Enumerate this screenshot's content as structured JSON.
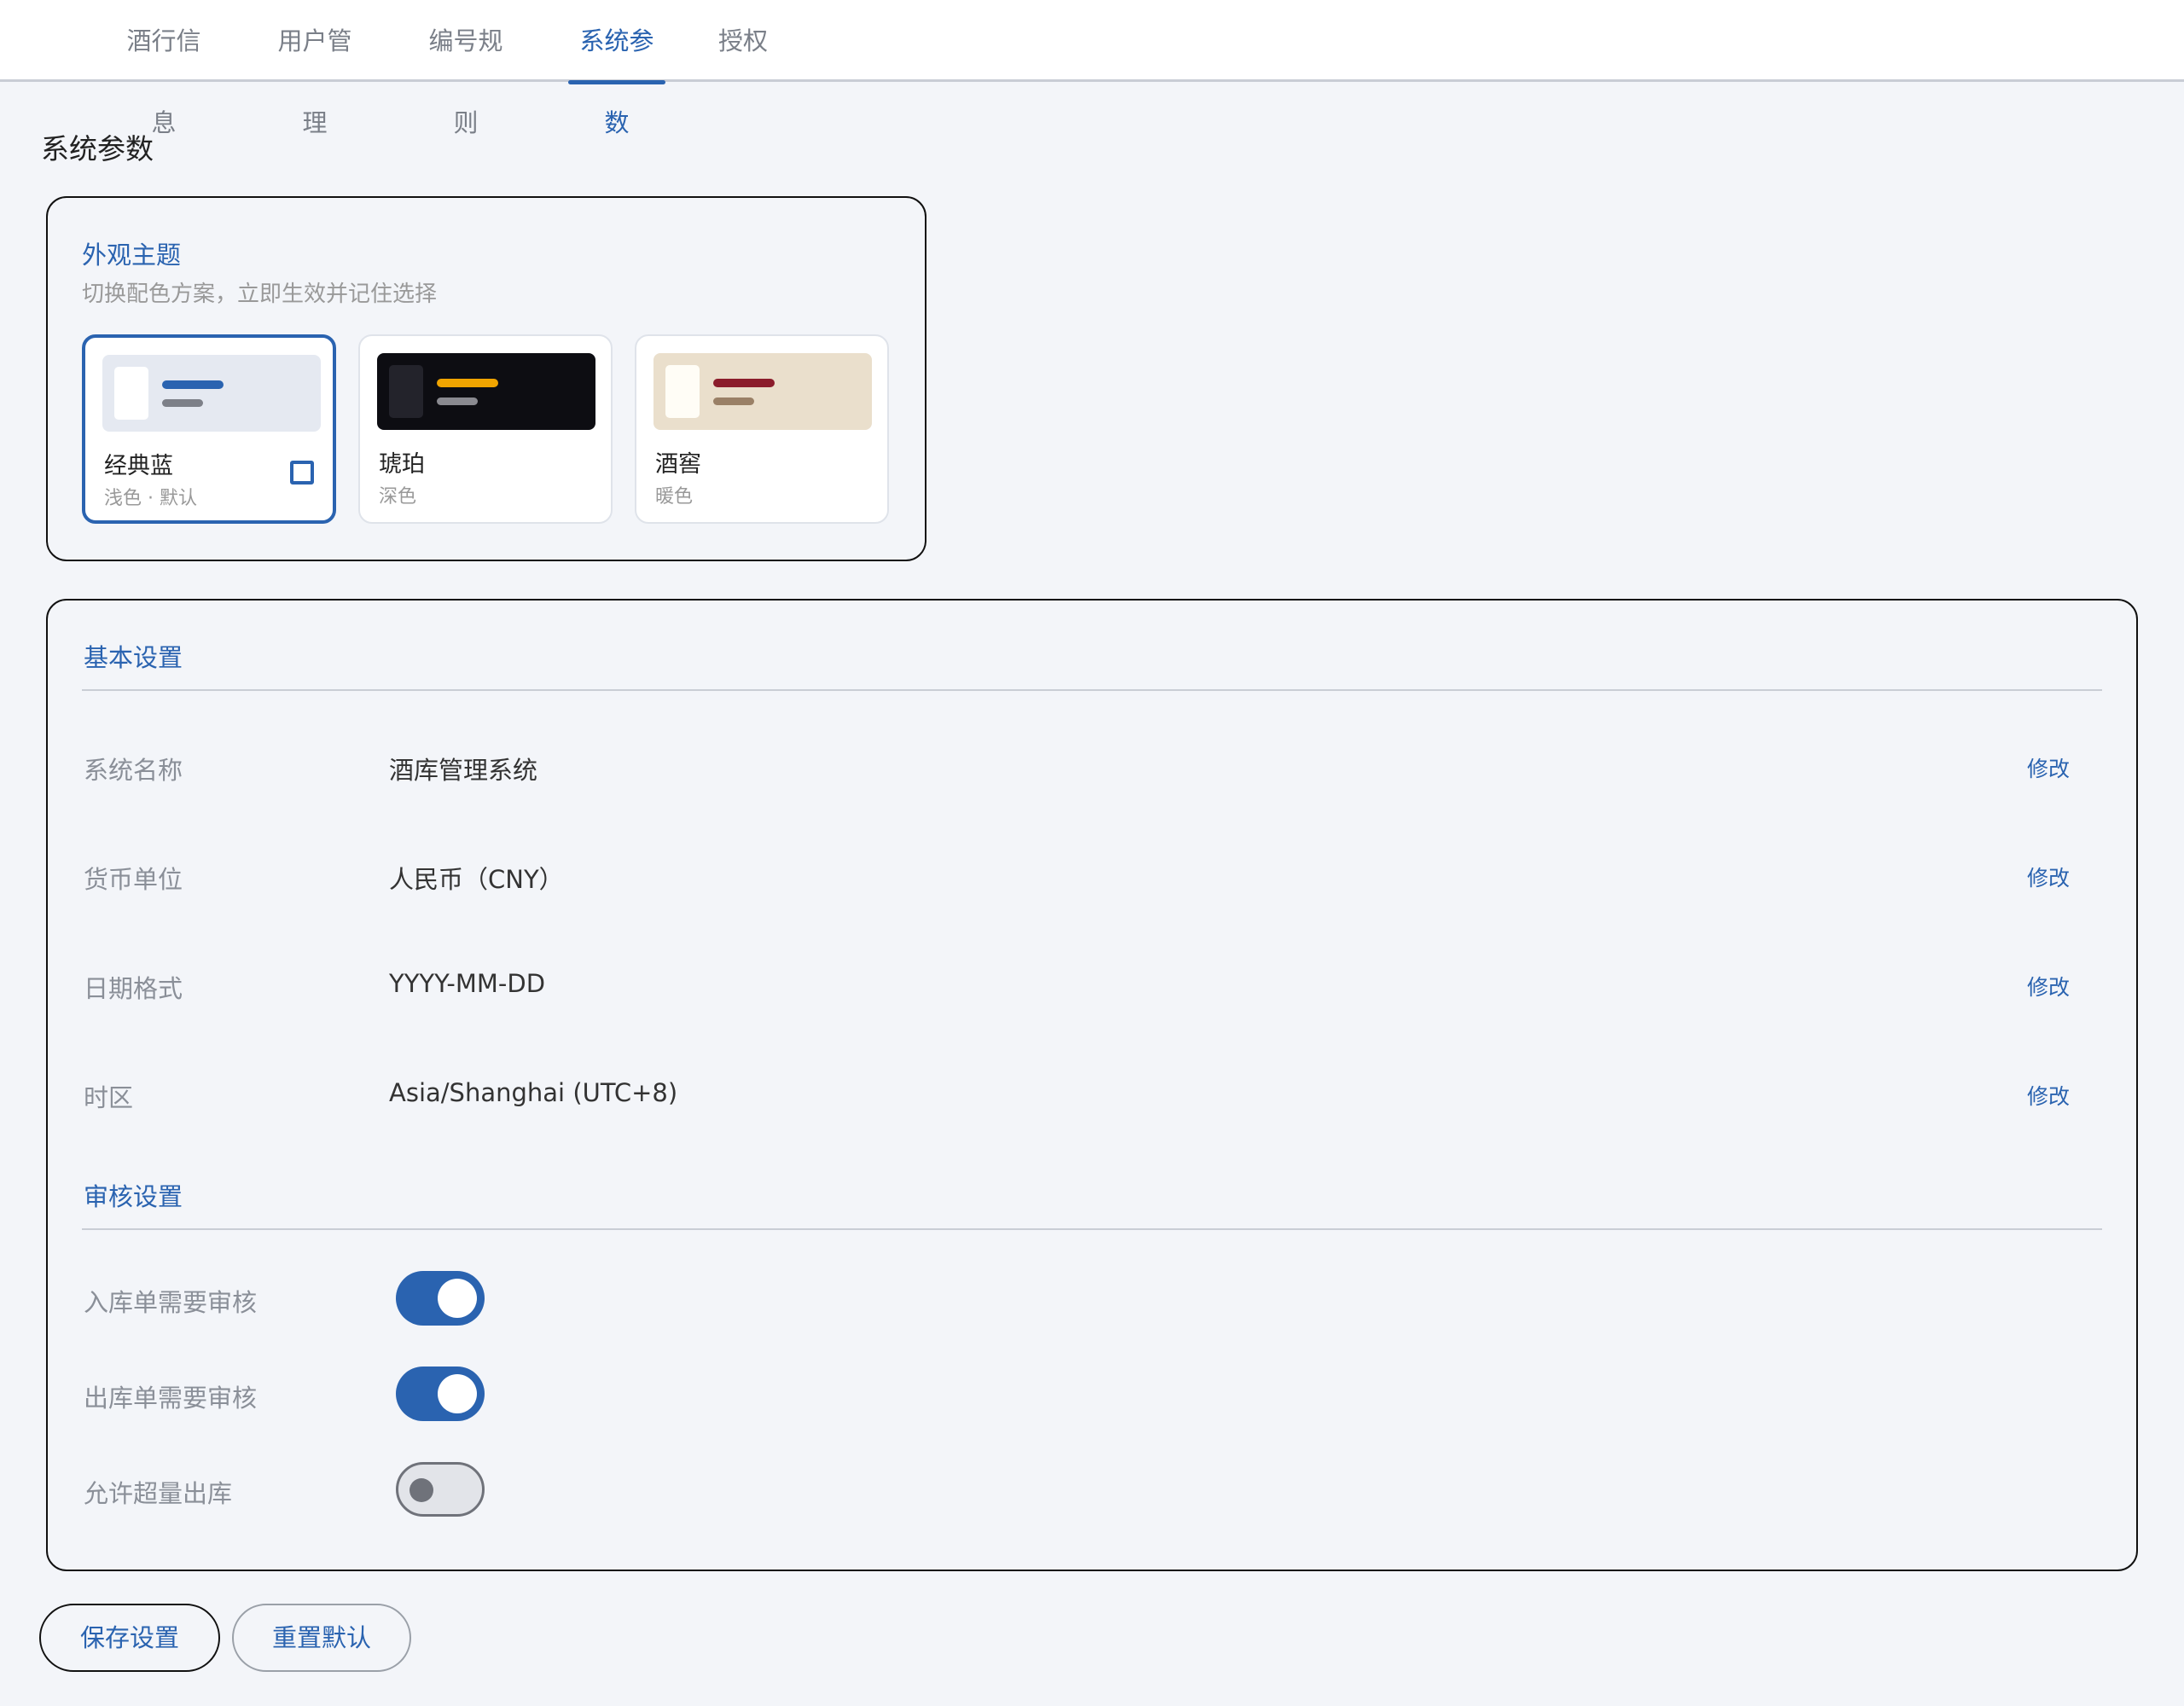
{
  "tabs": [
    {
      "label": "酒行信息",
      "active": false
    },
    {
      "label": "用户管理",
      "active": false
    },
    {
      "label": "编号规则",
      "active": false
    },
    {
      "label": "系统参数",
      "active": true
    },
    {
      "label": "授权",
      "active": false
    }
  ],
  "page_title": "系统参数",
  "theme": {
    "title": "外观主题",
    "subtitle": "切换配色方案，立即生效并记住选择",
    "options": [
      {
        "name": "经典蓝",
        "desc": "浅色 · 默认",
        "selected": true,
        "colors": {
          "bg": "#e5e9f1",
          "box": "#ffffff",
          "line1": "#2a63b0",
          "line2": "#7d8088"
        }
      },
      {
        "name": "琥珀",
        "desc": "深色",
        "selected": false,
        "colors": {
          "bg": "#0d0d12",
          "box": "#23232b",
          "line1": "#f0a400",
          "line2": "#8a8a90"
        }
      },
      {
        "name": "酒窖",
        "desc": "暖色",
        "selected": false,
        "colors": {
          "bg": "#eadfcc",
          "box": "#fffdf6",
          "line1": "#8b1c2b",
          "line2": "#9a8066"
        }
      }
    ]
  },
  "basic": {
    "title": "基本设置",
    "rows": [
      {
        "label": "系统名称",
        "value": "酒库管理系统",
        "action": "修改"
      },
      {
        "label": "货币单位",
        "value": "人民币（CNY）",
        "action": "修改"
      },
      {
        "label": "日期格式",
        "value": "YYYY-MM-DD",
        "action": "修改"
      },
      {
        "label": "时区",
        "value": "Asia/Shanghai (UTC+8)",
        "action": "修改"
      }
    ]
  },
  "audit": {
    "title": "审核设置",
    "toggles": [
      {
        "label": "入库单需要审核",
        "on": true
      },
      {
        "label": "出库单需要审核",
        "on": true
      },
      {
        "label": "允许超量出库",
        "on": false
      }
    ]
  },
  "buttons": {
    "save": "保存设置",
    "reset": "重置默认"
  },
  "colors": {
    "accent": "#2a63b0",
    "page_bg": "#f3f5f9"
  }
}
